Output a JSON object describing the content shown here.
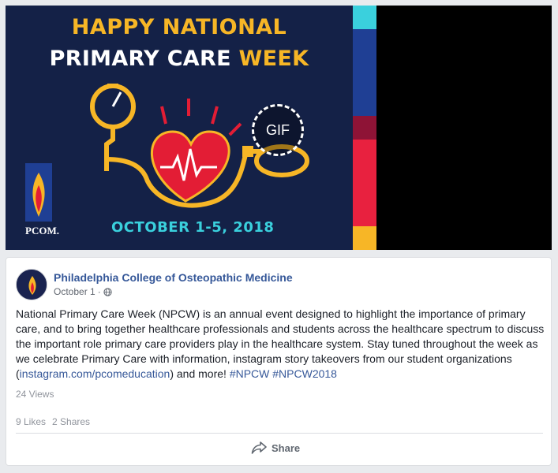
{
  "media": {
    "headline_line1": "HAPPY NATIONAL",
    "headline_line2_white": "PRIMARY CARE ",
    "headline_line2_accent": "WEEK",
    "dates": "OCTOBER 1-5, 2018",
    "logo_text": "PCOM.",
    "gif_label": "GIF",
    "colors": {
      "background": "#142147",
      "accent": "#f7b626",
      "heart": "#e31d35",
      "dates": "#3ad0dd",
      "stripes": [
        "#3ad0dd",
        "#1f3f94",
        "#1f3f94",
        "#8e1336",
        "#e8213f",
        "#f7b626"
      ]
    }
  },
  "post": {
    "author": "Philadelphia College of Osteopathic Medicine",
    "date": "October 1",
    "separator": "·",
    "privacy_icon": "globe-icon",
    "text_before_link": "National Primary Care Week (NPCW) is an annual event designed to highlight the importance of primary care, and to bring together healthcare professionals and students across the healthcare spectrum to discuss the important role primary care providers play in the healthcare system. Stay tuned throughout the week as we celebrate Primary Care with information, instagram story takeovers from our student organizations (",
    "link_text": "instagram.com/pcomeducation",
    "text_after_link": ") and more! ",
    "hashtag1": "#NPCW",
    "hashtag_space": " ",
    "hashtag2": "#NPCW2018",
    "views": "24 Views",
    "likes": "9 Likes",
    "shares": "2 Shares",
    "share_button": "Share",
    "share_icon": "share-arrow-icon"
  }
}
